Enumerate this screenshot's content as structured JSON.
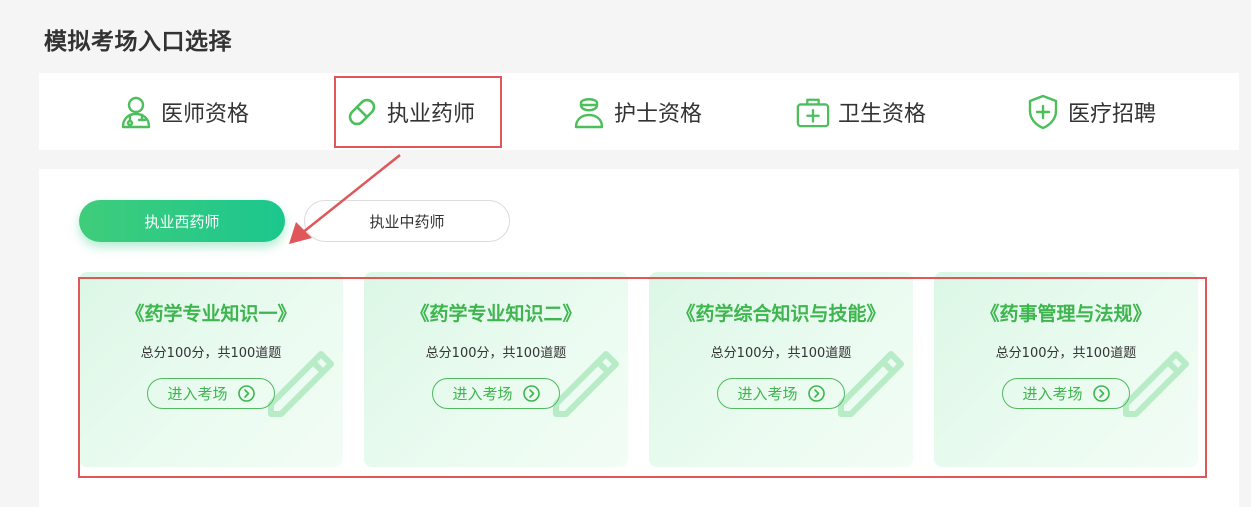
{
  "page": {
    "title": "模拟考场入口选择"
  },
  "categories": [
    {
      "label": "医师资格",
      "icon": "doctor-icon"
    },
    {
      "label": "执业药师",
      "icon": "pill-icon"
    },
    {
      "label": "护士资格",
      "icon": "nurse-icon"
    },
    {
      "label": "卫生资格",
      "icon": "medkit-icon"
    },
    {
      "label": "医疗招聘",
      "icon": "shield-plus-icon"
    }
  ],
  "sub_tabs": [
    {
      "label": "执业西药师",
      "active": true
    },
    {
      "label": "执业中药师",
      "active": false
    }
  ],
  "cards": [
    {
      "title": "《药学专业知识一》",
      "desc": "总分100分，共100道题",
      "button": "进入考场"
    },
    {
      "title": "《药学专业知识二》",
      "desc": "总分100分，共100道题",
      "button": "进入考场"
    },
    {
      "title": "《药学综合知识与技能》",
      "desc": "总分100分，共100道题",
      "button": "进入考场"
    },
    {
      "title": "《药事管理与法规》",
      "desc": "总分100分，共100道题",
      "button": "进入考场"
    }
  ],
  "colors": {
    "accent": "#4cbf5c",
    "highlight": "#e0575a",
    "tab_gradient_start": "#3fcd7a",
    "tab_gradient_end": "#1bc78f"
  }
}
